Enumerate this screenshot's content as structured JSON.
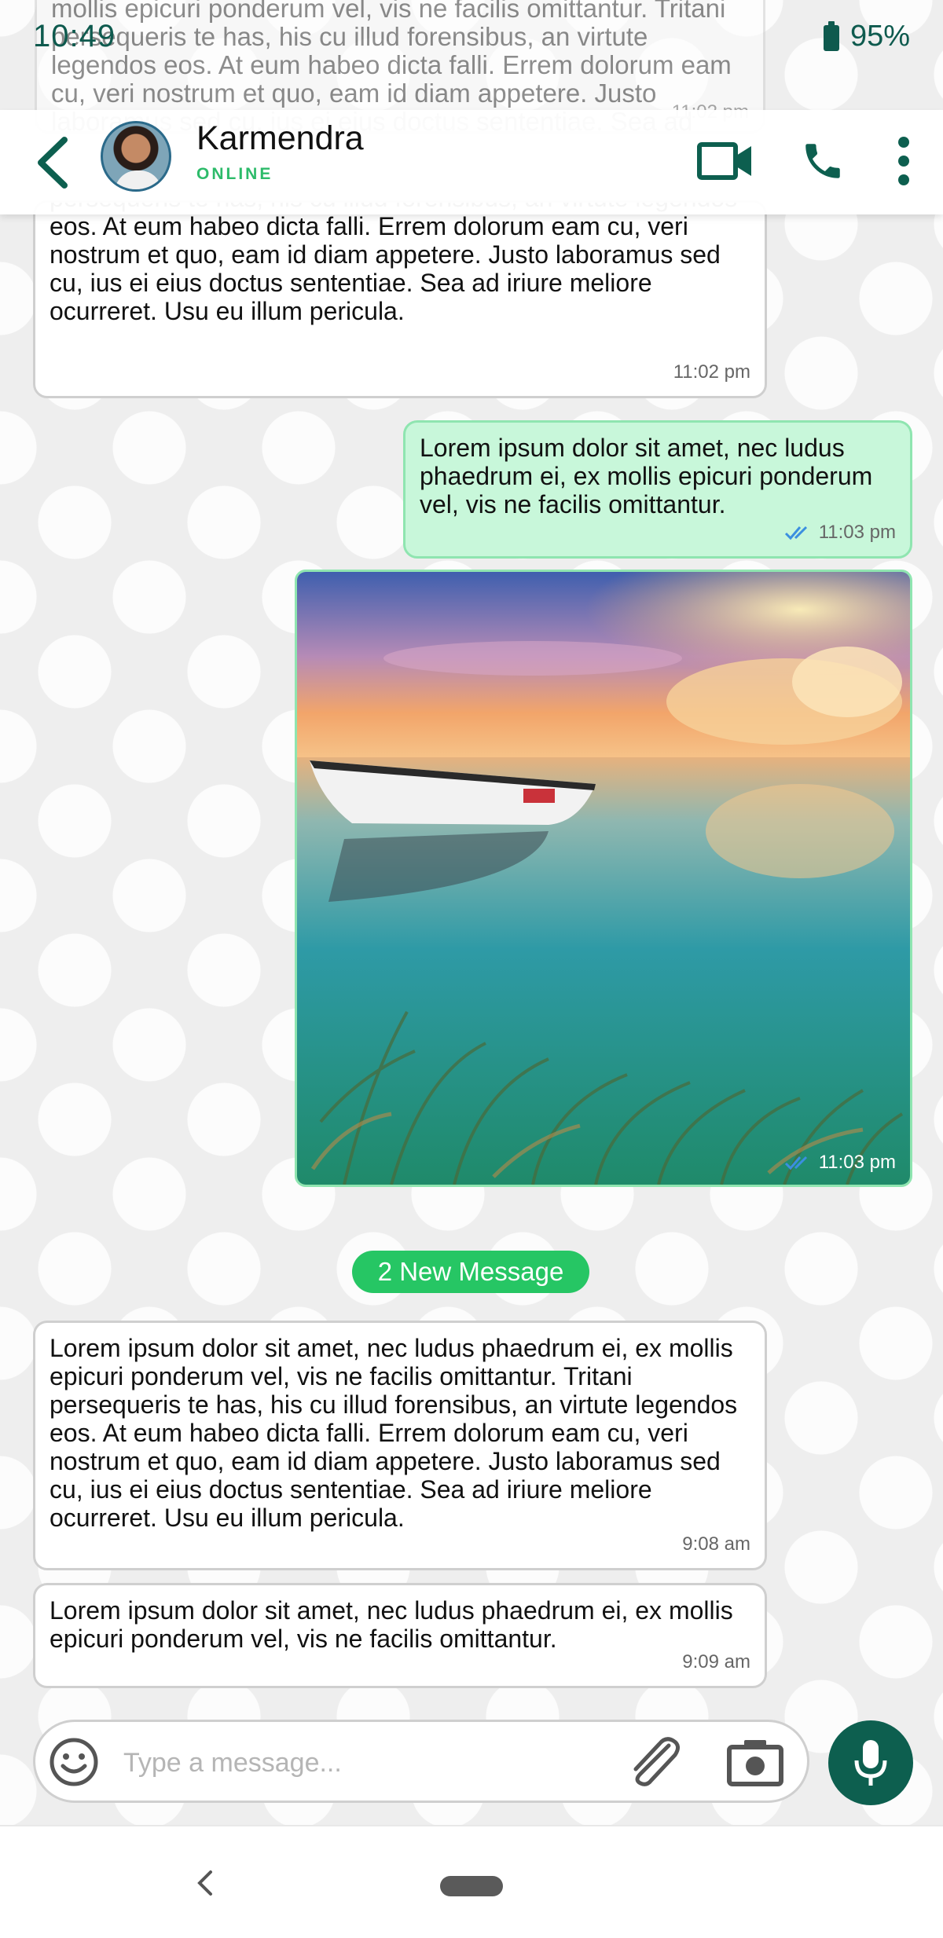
{
  "status_bar": {
    "time": "10:49",
    "battery": "95%"
  },
  "header": {
    "contact_name": "Karmendra",
    "contact_status": "ONLINE"
  },
  "messages": [
    {
      "direction": "incoming",
      "text": "Lorem ipsum dolor sit amet, nec ludus phaedrum ei, ex mollis epicuri ponderum vel, vis ne facilis omittantur. Tritani persequeris te has, his cu illud forensibus, an virtute legendos eos. At eum habeo dicta falli. Errem dolorum eam cu, veri nostrum et quo, eam id diam appetere. Justo laboramus sed cu, ius ei eius doctus sententiae. Sea ad iriure meliore ocurreret. Usu eu illum pericula.",
      "time": "11:02 pm"
    },
    {
      "direction": "incoming",
      "text": "Lorem ipsum dolor sit amet, nec ludus phaedrum ei, ex mollis epicuri ponderum vel, vis ne facilis omittantur. Tritani persequeris te has, his cu illud forensibus, an virtute legendos eos. At eum habeo dicta falli. Errem dolorum eam cu, veri nostrum et quo, eam id diam appetere. Justo laboramus sed cu, ius ei eius doctus sententiae. Sea ad iriure meliore ocurreret. Usu eu illum pericula.",
      "time": "11:02 pm"
    },
    {
      "direction": "outgoing",
      "text": "Lorem ipsum dolor sit amet, nec ludus phaedrum ei, ex mollis epicuri ponderum vel, vis ne facilis omittantur.",
      "time": "11:03 pm"
    },
    {
      "direction": "outgoing",
      "type": "image",
      "time": "11:03 pm"
    },
    {
      "direction": "incoming",
      "text": "Lorem ipsum dolor sit amet, nec ludus phaedrum ei, ex mollis epicuri ponderum vel, vis ne facilis omittantur. Tritani persequeris te has, his cu illud forensibus, an virtute legendos eos. At eum habeo dicta falli. Errem dolorum eam cu, veri nostrum et quo, eam id diam appetere. Justo laboramus sed cu, ius ei eius doctus sententiae. Sea ad iriure meliore ocurreret. Usu eu illum pericula.",
      "time": "9:08 am"
    },
    {
      "direction": "incoming",
      "text": "Lorem ipsum dolor sit amet, nec ludus phaedrum ei, ex mollis epicuri ponderum vel, vis ne facilis omittantur.",
      "time": "9:09 am"
    }
  ],
  "new_messages_label": "2 New Message",
  "composer": {
    "placeholder": "Type a message..."
  },
  "icons": {
    "back": "back-arrow-icon",
    "video": "video-call-icon",
    "call": "phone-icon",
    "more": "more-vert-icon",
    "emoji": "emoji-icon",
    "attach": "paperclip-icon",
    "camera": "camera-icon",
    "mic": "mic-icon",
    "read_receipt": "double-check-icon"
  },
  "colors": {
    "primary": "#0d5f4f",
    "accent_green": "#26c664",
    "outgoing_bubble": "#c8f7da",
    "read_tick": "#3b8fe0"
  }
}
